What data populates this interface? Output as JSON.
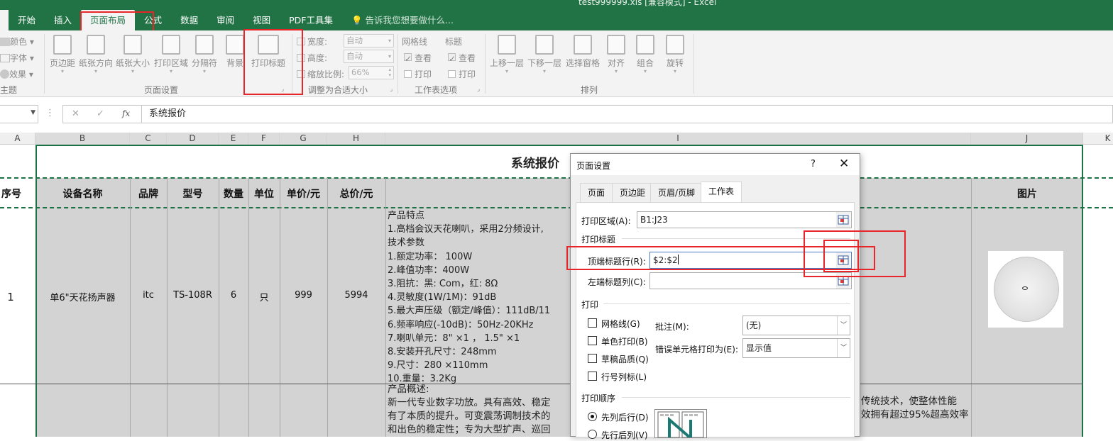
{
  "window": {
    "title": "test999999.xls [兼容模式] - Excel"
  },
  "ribbon_tabs": [
    "开始",
    "插入",
    "页面布局",
    "公式",
    "数据",
    "审阅",
    "视图",
    "PDF工具集"
  ],
  "tell_me": "告诉我您想要做什么...",
  "ribbon": {
    "theme_items": [
      "颜色",
      "字体",
      "效果"
    ],
    "theme_group": "主题",
    "page_setup_buttons": [
      "页边距",
      "纸张方向",
      "纸张大小",
      "打印区域",
      "分隔符",
      "背景",
      "打印标题"
    ],
    "page_setup_group": "页面设置",
    "scale": {
      "width_label": "宽度:",
      "width_value": "自动",
      "height_label": "高度:",
      "height_value": "自动",
      "zoom_label": "缩放比例:",
      "zoom_value": "66%",
      "group": "调整为合适大小"
    },
    "sheet_opts": {
      "gridlines": "网格线",
      "headings": "标题",
      "view": "查看",
      "print": "打印",
      "group": "工作表选项"
    },
    "arrange_buttons": [
      "上移一层",
      "下移一层",
      "选择窗格",
      "对齐",
      "组合",
      "旋转"
    ],
    "arrange_group": "排列"
  },
  "formula_bar": {
    "cancel": "✕",
    "enter": "✓",
    "fx": "fx",
    "content": "系统报价"
  },
  "columns": [
    "A",
    "B",
    "C",
    "D",
    "E",
    "F",
    "G",
    "H",
    "I",
    "J",
    "K"
  ],
  "sheet": {
    "title": "系统报价",
    "headers": [
      "序号",
      "设备名称",
      "品牌",
      "型号",
      "数量",
      "单位",
      "单价/元",
      "总价/元",
      "图片"
    ],
    "row1": {
      "no": "1",
      "name": "单6\"天花扬声器",
      "brand": "itc",
      "model": "TS-108R",
      "qty": "6",
      "unit": "只",
      "price": "999",
      "total": "5994"
    },
    "row1_desc": [
      "产品特点",
      "1.高档会议天花喇叭，采用2分频设计,",
      "技术参数",
      "1.额定功率： 100W",
      "2.峰值功率：400W",
      "3.阻抗：黑: Com，红: 8Ω",
      "4.灵敏度(1W/1M)：91dB",
      "5.最大声压级（额定/峰值）：111dB/11",
      "6.频率响应(-10dB)：50Hz-20KHz",
      "7.喇叭单元：8\" ×1 ， 1.5\" ×1",
      "8.安装开孔尺寸：248mm",
      "9.尺寸：280 ×110mm",
      "10.重量：3.2Kg"
    ],
    "row2_desc": [
      "产品概述:",
      "  新一代专业数字功放。具有高效、稳定",
      "有了本质的提升。可变震荡调制技术的",
      "和出色的稳定性；专为大型扩声、巡回"
    ],
    "row2_right": [
      "传统技术，使整体性能",
      "效拥有超过95%超高效率"
    ]
  },
  "dialog": {
    "title": "页面设置",
    "help": "?",
    "tabs": [
      "页面",
      "页边距",
      "页眉/页脚",
      "工作表"
    ],
    "print_area_label": "打印区域(A):",
    "print_area_value": "B1:J23",
    "print_titles_section": "打印标题",
    "rows_repeat_label": "顶端标题行(R):",
    "rows_repeat_value": "$2:$2",
    "cols_repeat_label": "左端标题列(C):",
    "cols_repeat_value": "",
    "print_section": "打印",
    "checks": [
      "网格线(G)",
      "单色打印(B)",
      "草稿品质(Q)",
      "行号列标(L)"
    ],
    "comments_label": "批注(M):",
    "comments_value": "(无)",
    "errors_label": "错误单元格打印为(E):",
    "errors_value": "显示值",
    "order_section": "打印顺序",
    "order_options": [
      "先列后行(D)",
      "先行后列(V)"
    ]
  }
}
